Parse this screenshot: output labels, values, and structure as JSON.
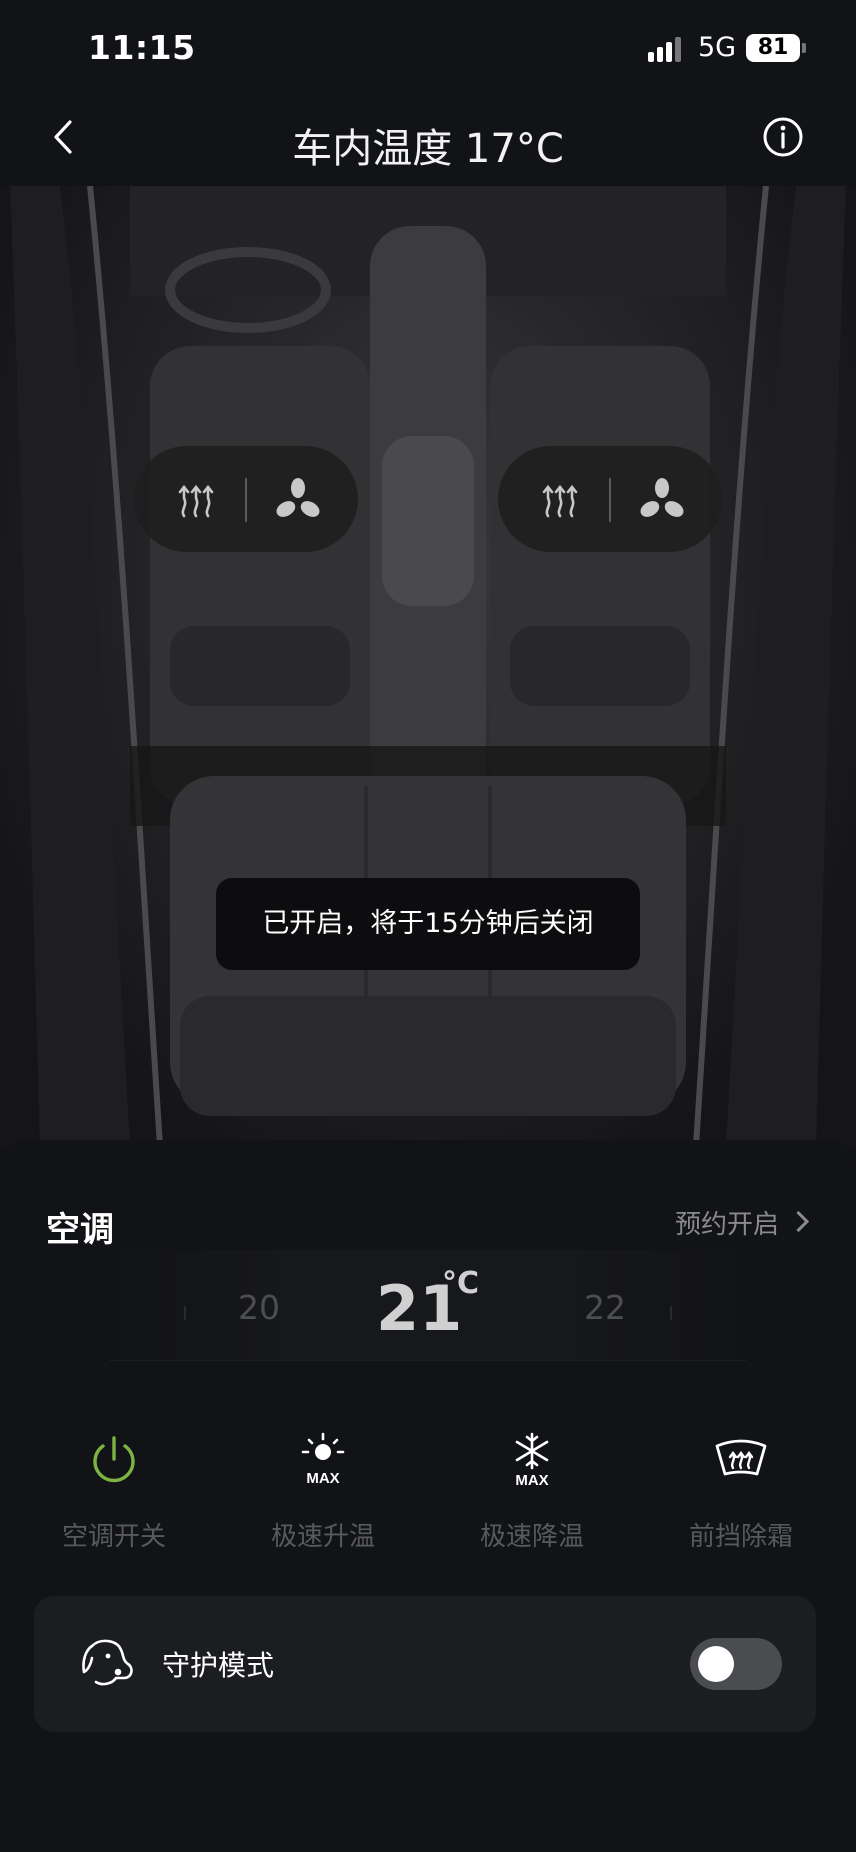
{
  "status_bar": {
    "time": "11:15",
    "network": "5G",
    "battery": "81"
  },
  "header": {
    "title": "车内温度 17°C"
  },
  "toast": {
    "text": "已开启，将于15分钟后关闭"
  },
  "ac": {
    "title": "空调",
    "schedule_label": "预约开启",
    "temperature": {
      "prev": "20",
      "current": "21",
      "unit": "°C",
      "next": "22"
    }
  },
  "controls": [
    {
      "label": "空调开关",
      "icon": "power-icon",
      "active": true
    },
    {
      "label": "极速升温",
      "icon": "sun-max-icon",
      "active": false
    },
    {
      "label": "极速降温",
      "icon": "snowflake-max-icon",
      "active": false
    },
    {
      "label": "前挡除霜",
      "icon": "windshield-defrost-icon",
      "active": false
    }
  ],
  "guard_mode": {
    "label": "守护模式",
    "enabled": false
  },
  "colors": {
    "accent_green": "#7cb342",
    "background": "#121316",
    "card": "#1c1d21"
  }
}
